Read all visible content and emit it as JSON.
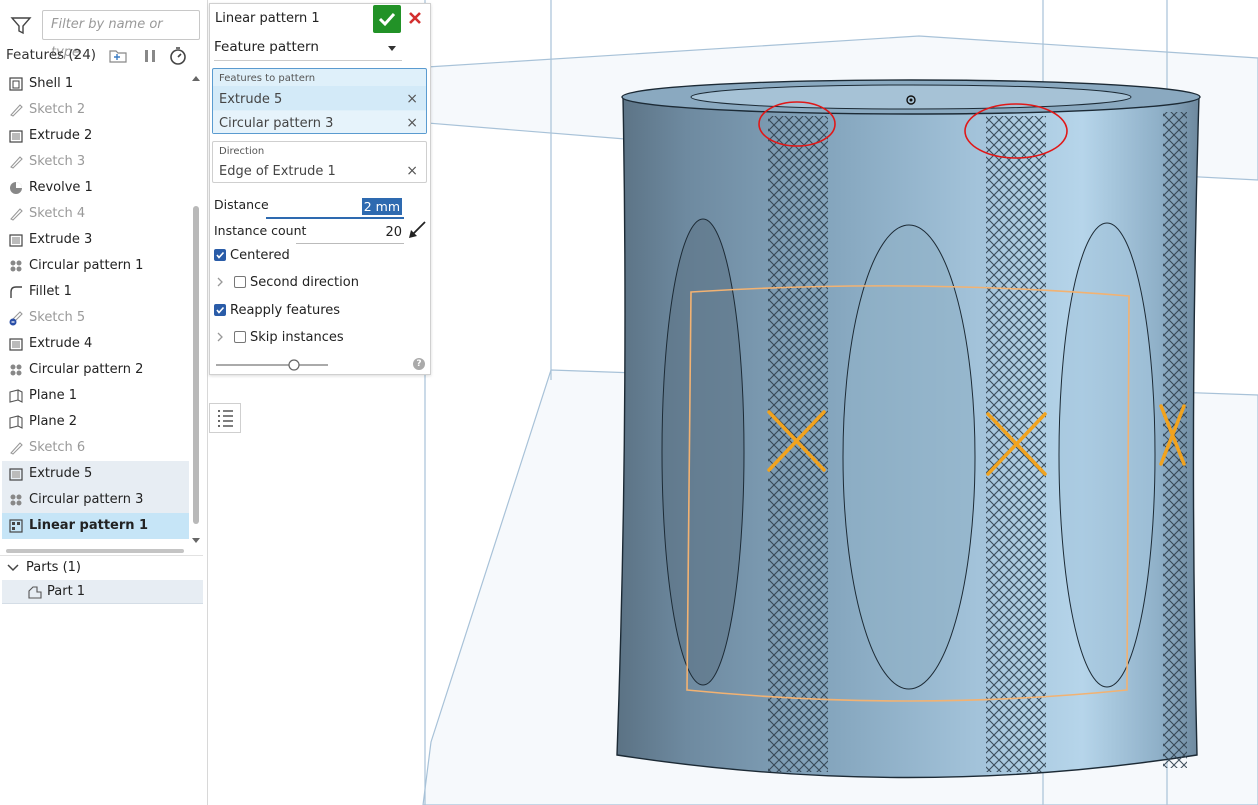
{
  "search": {
    "placeholder": "Filter by name or type"
  },
  "features": {
    "title": "Features (24)",
    "items": [
      {
        "label": "Shell 1",
        "icon": "shell-icon",
        "state": "normal"
      },
      {
        "label": "Sketch 2",
        "icon": "sketch-icon",
        "state": "sketch"
      },
      {
        "label": "Extrude 2",
        "icon": "extrude-icon",
        "state": "normal"
      },
      {
        "label": "Sketch 3",
        "icon": "sketch-icon",
        "state": "sketch"
      },
      {
        "label": "Revolve 1",
        "icon": "revolve-icon",
        "state": "normal"
      },
      {
        "label": "Sketch 4",
        "icon": "sketch-icon",
        "state": "sketch"
      },
      {
        "label": "Extrude 3",
        "icon": "extrude-icon",
        "state": "normal"
      },
      {
        "label": "Circular pattern 1",
        "icon": "circular-pattern-icon",
        "state": "normal"
      },
      {
        "label": "Fillet 1",
        "icon": "fillet-icon",
        "state": "normal"
      },
      {
        "label": "Sketch 5",
        "icon": "sketch-error-icon",
        "state": "sketch"
      },
      {
        "label": "Extrude 4",
        "icon": "extrude-icon",
        "state": "normal"
      },
      {
        "label": "Circular pattern 2",
        "icon": "circular-pattern-icon",
        "state": "normal"
      },
      {
        "label": "Plane 1",
        "icon": "plane-icon",
        "state": "normal"
      },
      {
        "label": "Plane 2",
        "icon": "plane-icon",
        "state": "normal"
      },
      {
        "label": "Sketch 6",
        "icon": "sketch-icon",
        "state": "sketch"
      },
      {
        "label": "Extrude 5",
        "icon": "extrude-icon",
        "state": "highlight"
      },
      {
        "label": "Circular pattern 3",
        "icon": "circular-pattern-icon",
        "state": "highlight"
      },
      {
        "label": "Linear pattern 1",
        "icon": "linear-pattern-icon",
        "state": "selected"
      }
    ]
  },
  "parts": {
    "title": "Parts (1)",
    "items": [
      {
        "label": "Part 1"
      }
    ]
  },
  "dialog": {
    "title": "Linear pattern 1",
    "pattern_type": "Feature pattern",
    "features_label": "Features to pattern",
    "features": [
      "Extrude 5",
      "Circular pattern 3"
    ],
    "direction_label": "Direction",
    "direction_value": "Edge of Extrude 1",
    "distance_label": "Distance",
    "distance_value": "2 mm",
    "count_label": "Instance count",
    "count_value": "20",
    "centered_label": "Centered",
    "centered": true,
    "second_direction_label": "Second direction",
    "second_direction": false,
    "reapply_label": "Reapply features",
    "reapply": true,
    "skip_label": "Skip instances",
    "skip": false,
    "help_label": "?"
  },
  "colors": {
    "accent_blue": "#2e6ab0",
    "confirm_green": "#229227",
    "cancel_red": "#d32f2f",
    "selection_orange": "#f5a623",
    "annotation_red": "#e01818",
    "part_blue": "#7d9fb6"
  }
}
